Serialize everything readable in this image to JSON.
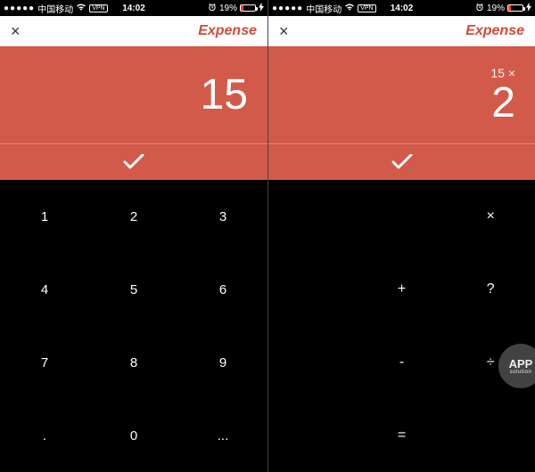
{
  "statusbar": {
    "signal_dots": "●●●●●",
    "carrier": "中国移动",
    "vpn": "VPN",
    "time": "14:02",
    "battery_pct": "19%"
  },
  "nav": {
    "close": "×",
    "title": "Expense"
  },
  "left": {
    "prev": "",
    "main": "15",
    "keys": [
      "1",
      "2",
      "3",
      "4",
      "5",
      "6",
      "7",
      "8",
      "9",
      ".",
      "0",
      "..."
    ]
  },
  "right": {
    "prev": "15 ×",
    "main": "2",
    "keys": [
      "",
      "",
      "×",
      "",
      "+",
      "?",
      "",
      "-",
      "÷",
      "",
      "=",
      ""
    ]
  },
  "colors": {
    "accent": "#d25a4a",
    "expense": "#d24a3b",
    "bg_dark": "#000000",
    "bg_light": "#ffffff"
  },
  "watermark": {
    "top": "APP",
    "bottom": "solution"
  }
}
